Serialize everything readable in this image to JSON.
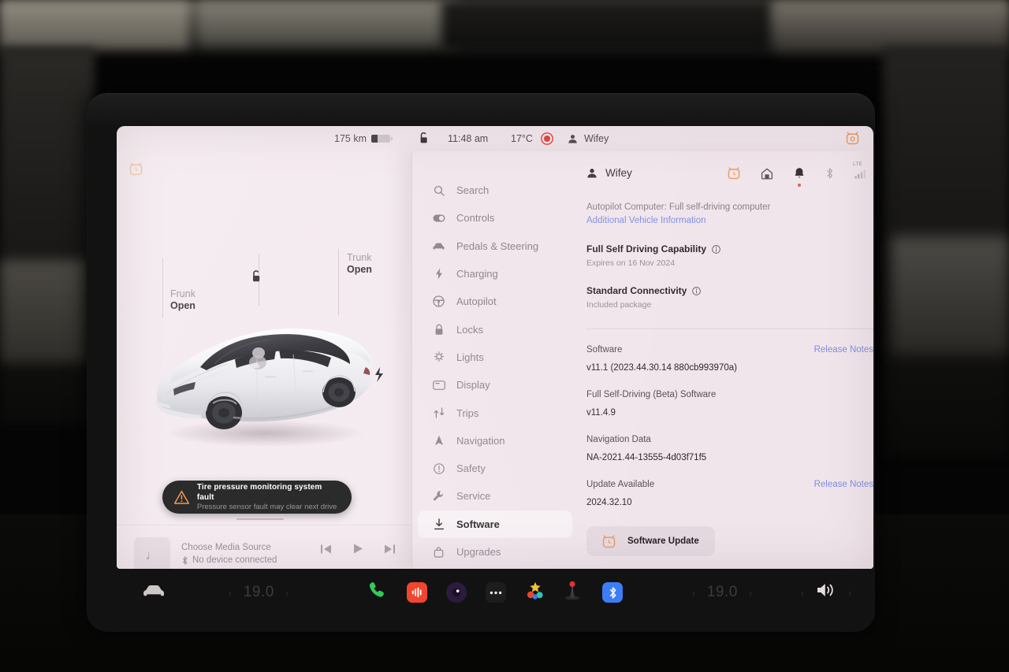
{
  "statusbar": {
    "range": "175 km",
    "lock_icon": "unlock-icon",
    "time": "11:48 am",
    "temperature": "17°C",
    "record_icon": "dashcam-record-icon",
    "profile_icon": "person-icon",
    "profile_name": "Wifey",
    "corner_badge_icon": "software-update-badge-icon"
  },
  "vehicle": {
    "top_left_badge_icon": "software-update-badge-icon",
    "unlock_icon": "unlock-icon",
    "frunk": {
      "title": "Frunk",
      "state": "Open"
    },
    "trunk": {
      "title": "Trunk",
      "state": "Open"
    },
    "car_image": "tesla-model-y-white"
  },
  "alert": {
    "icon": "warning-triangle-icon",
    "title": "Tire pressure monitoring system fault",
    "subtitle": "Pressure sensor fault may clear next drive"
  },
  "media": {
    "art_icon": "music-note-icon",
    "title": "Choose Media Source",
    "bluetooth_icon": "bluetooth-icon",
    "subtitle": "No device connected",
    "prev_icon": "skip-previous-icon",
    "play_icon": "play-icon",
    "next_icon": "skip-next-icon"
  },
  "sidebar": {
    "items": [
      {
        "label": "Search",
        "icon": "search-icon",
        "active": false
      },
      {
        "label": "Controls",
        "icon": "toggle-icon",
        "active": false
      },
      {
        "label": "Pedals & Steering",
        "icon": "car-icon",
        "active": false
      },
      {
        "label": "Charging",
        "icon": "bolt-icon",
        "active": false
      },
      {
        "label": "Autopilot",
        "icon": "steering-wheel-icon",
        "active": false
      },
      {
        "label": "Locks",
        "icon": "lock-icon",
        "active": false
      },
      {
        "label": "Lights",
        "icon": "lightbulb-icon",
        "active": false
      },
      {
        "label": "Display",
        "icon": "display-icon",
        "active": false
      },
      {
        "label": "Trips",
        "icon": "trips-icon",
        "active": false
      },
      {
        "label": "Navigation",
        "icon": "navigation-arrow-icon",
        "active": false
      },
      {
        "label": "Safety",
        "icon": "info-circle-icon",
        "active": false
      },
      {
        "label": "Service",
        "icon": "wrench-icon",
        "active": false
      },
      {
        "label": "Software",
        "icon": "download-icon",
        "active": true
      },
      {
        "label": "Upgrades",
        "icon": "bag-icon",
        "active": false
      }
    ]
  },
  "panel": {
    "profile_icon": "person-icon",
    "profile_name": "Wifey",
    "status_icons": [
      "software-update-badge-icon",
      "home-icon",
      "notification-bell-icon",
      "bluetooth-icon",
      "lte-signal-icon"
    ],
    "lte_label": "LTE",
    "autopilot_computer": "Autopilot Computer: Full self-driving computer",
    "additional_info_link": "Additional Vehicle Information",
    "fsd": {
      "title": "Full Self Driving Capability",
      "info_icon": "info-circle-icon",
      "subtitle": "Expires on 16 Nov 2024"
    },
    "connectivity": {
      "title": "Standard Connectivity",
      "info_icon": "info-circle-icon",
      "subtitle": "Included package"
    },
    "software": {
      "label": "Software",
      "release_notes": "Release Notes",
      "version": "v11.1 (2023.44.30.14 880cb993970a)"
    },
    "fsd_beta": {
      "label": "Full Self-Driving (Beta) Software",
      "version": "v11.4.9"
    },
    "navigation_data": {
      "label": "Navigation Data",
      "version": "NA-2021.44-13555-4d03f71f5"
    },
    "update": {
      "label": "Update Available",
      "release_notes": "Release Notes",
      "version": "2024.32.10",
      "button_label": "Software Update",
      "button_icon": "clock-update-icon"
    }
  },
  "dock": {
    "car_icon": "car-icon",
    "driver_temp": "19.0",
    "passenger_temp": "19.0",
    "left_chevron": "‹",
    "right_chevron": "›",
    "apps": [
      {
        "icon": "phone-icon",
        "name": "phone-app"
      },
      {
        "icon": "media-waveform-icon",
        "name": "media-app"
      },
      {
        "icon": "camera-icon",
        "name": "camera-app"
      },
      {
        "icon": "more-dots-icon",
        "name": "more-apps"
      },
      {
        "icon": "toybox-icon",
        "name": "toybox-app"
      },
      {
        "icon": "joystick-icon",
        "name": "arcade-app"
      },
      {
        "icon": "bluetooth-icon",
        "name": "bluetooth-app"
      }
    ],
    "volume_icon": "volume-icon"
  },
  "colors": {
    "screen_bg": "#f3e9ee",
    "panel_bg": "#f0e5eb",
    "accent_link": "#7e8fe0",
    "accent_orange": "#e8913f",
    "alert_bg": "#0f0f10",
    "bluetooth_blue": "#3d7df5",
    "media_red": "#f0452f"
  }
}
